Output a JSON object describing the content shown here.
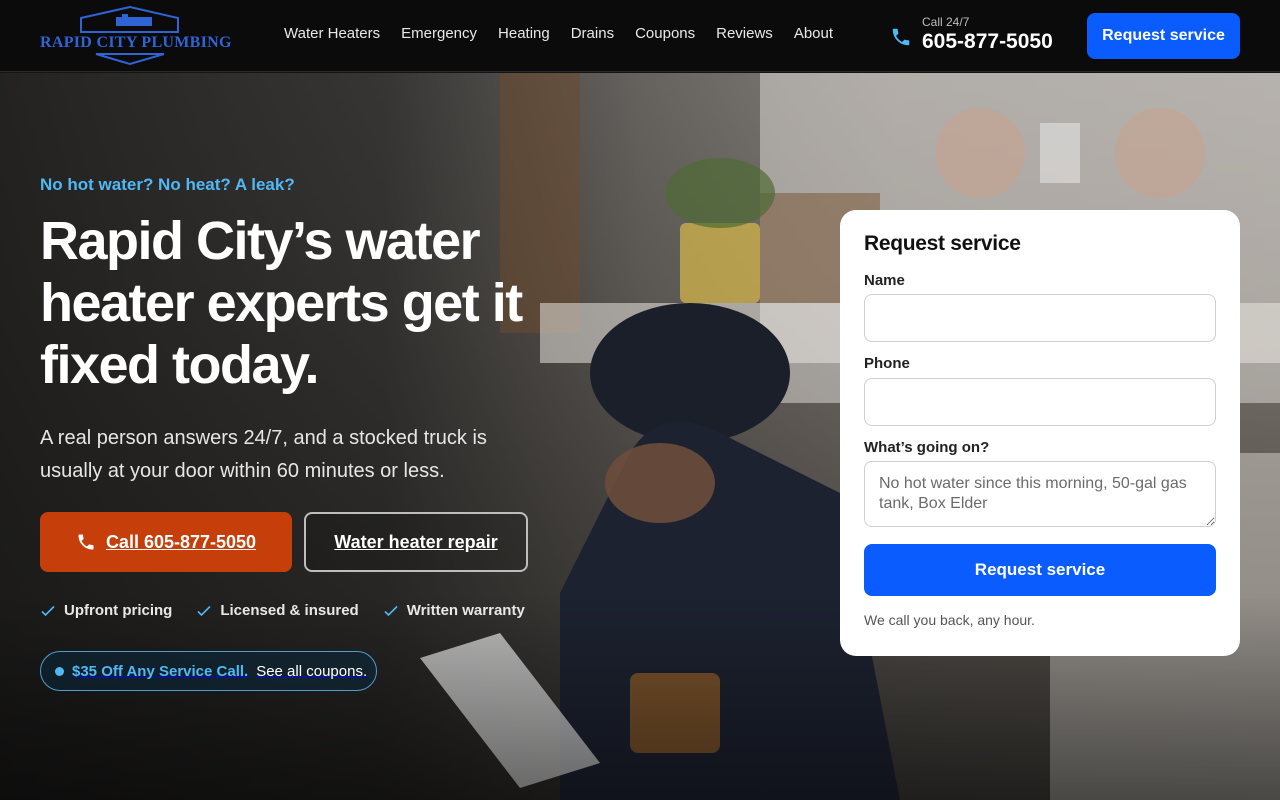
{
  "header": {
    "logo_text": "RAPID CITY PLUMBING",
    "nav": [
      "Water Heaters",
      "Emergency",
      "Heating",
      "Drains",
      "Coupons",
      "Reviews",
      "About"
    ],
    "call_label": "Call 24/7",
    "phone": "605-877-5050",
    "cta_label": "Request service"
  },
  "hero": {
    "kicker": "No hot water? No heat? A leak?",
    "headline": "Rapid City’s water heater experts get it fixed today.",
    "subhead": "A real person answers 24/7, and a stocked truck is usually at your door within 60 minutes or less.",
    "call_button": "Call 605-877-5050",
    "secondary_button": "Water heater repair",
    "checks": [
      "Upfront pricing",
      "Licensed & insured",
      "Written warranty"
    ],
    "coupon_highlight": "$35 Off Any Service Call.",
    "coupon_link": "See all coupons."
  },
  "form": {
    "title": "Request service",
    "name_label": "Name",
    "name_value": "",
    "phone_label": "Phone",
    "phone_value": "",
    "issue_label": "What’s going on?",
    "issue_placeholder": "No hot water since this morning, 50-gal gas tank, Box Elder",
    "submit_label": "Request service",
    "note": "We call you back, any hour."
  },
  "colors": {
    "brand_blue": "#0b5cff",
    "call_orange": "#c63f0a",
    "accent_cyan": "#4fb8f5"
  }
}
